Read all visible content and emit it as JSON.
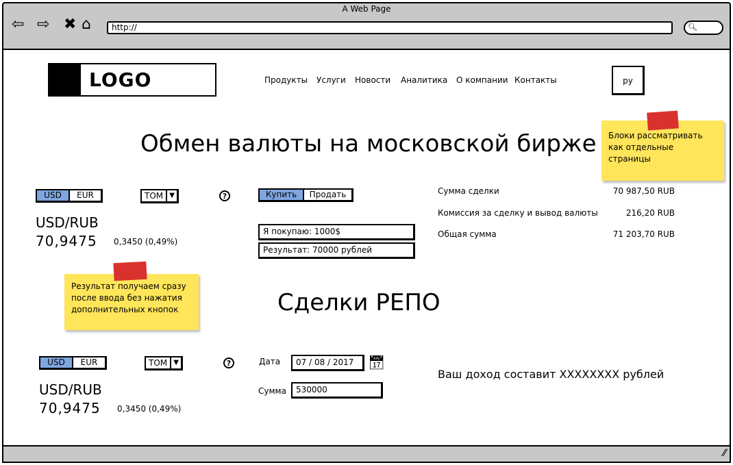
{
  "browser": {
    "window_title": "A Web Page",
    "url": "http://",
    "nav_icons": [
      "back-arrow-icon",
      "forward-arrow-icon",
      "close-x-icon",
      "home-icon"
    ],
    "search_icon": "search-icon"
  },
  "header": {
    "logo_text": "LOGO",
    "menu": [
      "Продукты",
      "Услуги",
      "Новости",
      "Аналитика",
      "О компании",
      "Контакты"
    ],
    "lang_button": "ру"
  },
  "exchange": {
    "title": "Обмен валюты на московской бирже",
    "currency_tabs": [
      "USD",
      "EUR"
    ],
    "currency_selected": "USD",
    "settlement": "TOM",
    "help": "?",
    "pair": "USD/RUB",
    "rate": "70,9475",
    "change": "0,3450 (0,49%)",
    "action_tabs": [
      "Купить",
      "Продать"
    ],
    "action_selected": "Купить",
    "buy_field": "Я покупаю: 1000$",
    "result_field": "Результат: 70000 рублей",
    "summary": [
      {
        "label": "Сумма сделки",
        "value": "70 987,50 RUB"
      },
      {
        "label": "Комиссия за сделку и вывод валюты",
        "value": "216,20 RUB"
      },
      {
        "label": "Общая сумма",
        "value": "71 203,70 RUB"
      }
    ]
  },
  "notes": {
    "pages_note": "Блоки рассматривать как отдельные страницы",
    "result_note": "Результат получаем сразу после ввода без нажатия дополнительных кнопок"
  },
  "repo": {
    "title": "Сделки РЕПО",
    "currency_tabs": [
      "USD",
      "EUR"
    ],
    "currency_selected": "USD",
    "settlement": "TOM",
    "help": "?",
    "pair": "USD/RUB",
    "rate": "70,9475",
    "change": "0,3450 (0,49%)",
    "date_label": "Дата",
    "date_value": "07 / 08 / 2017",
    "amount_label": "Сумма",
    "amount_value": "530000",
    "income_text": "Ваш доход составит XXXXXXXX рублей"
  },
  "colors": {
    "chrome": "#c8c8c8",
    "selected_tab": "#7fa6e0",
    "sticky_note": "#ffe55a",
    "tape": "#d9322e"
  }
}
